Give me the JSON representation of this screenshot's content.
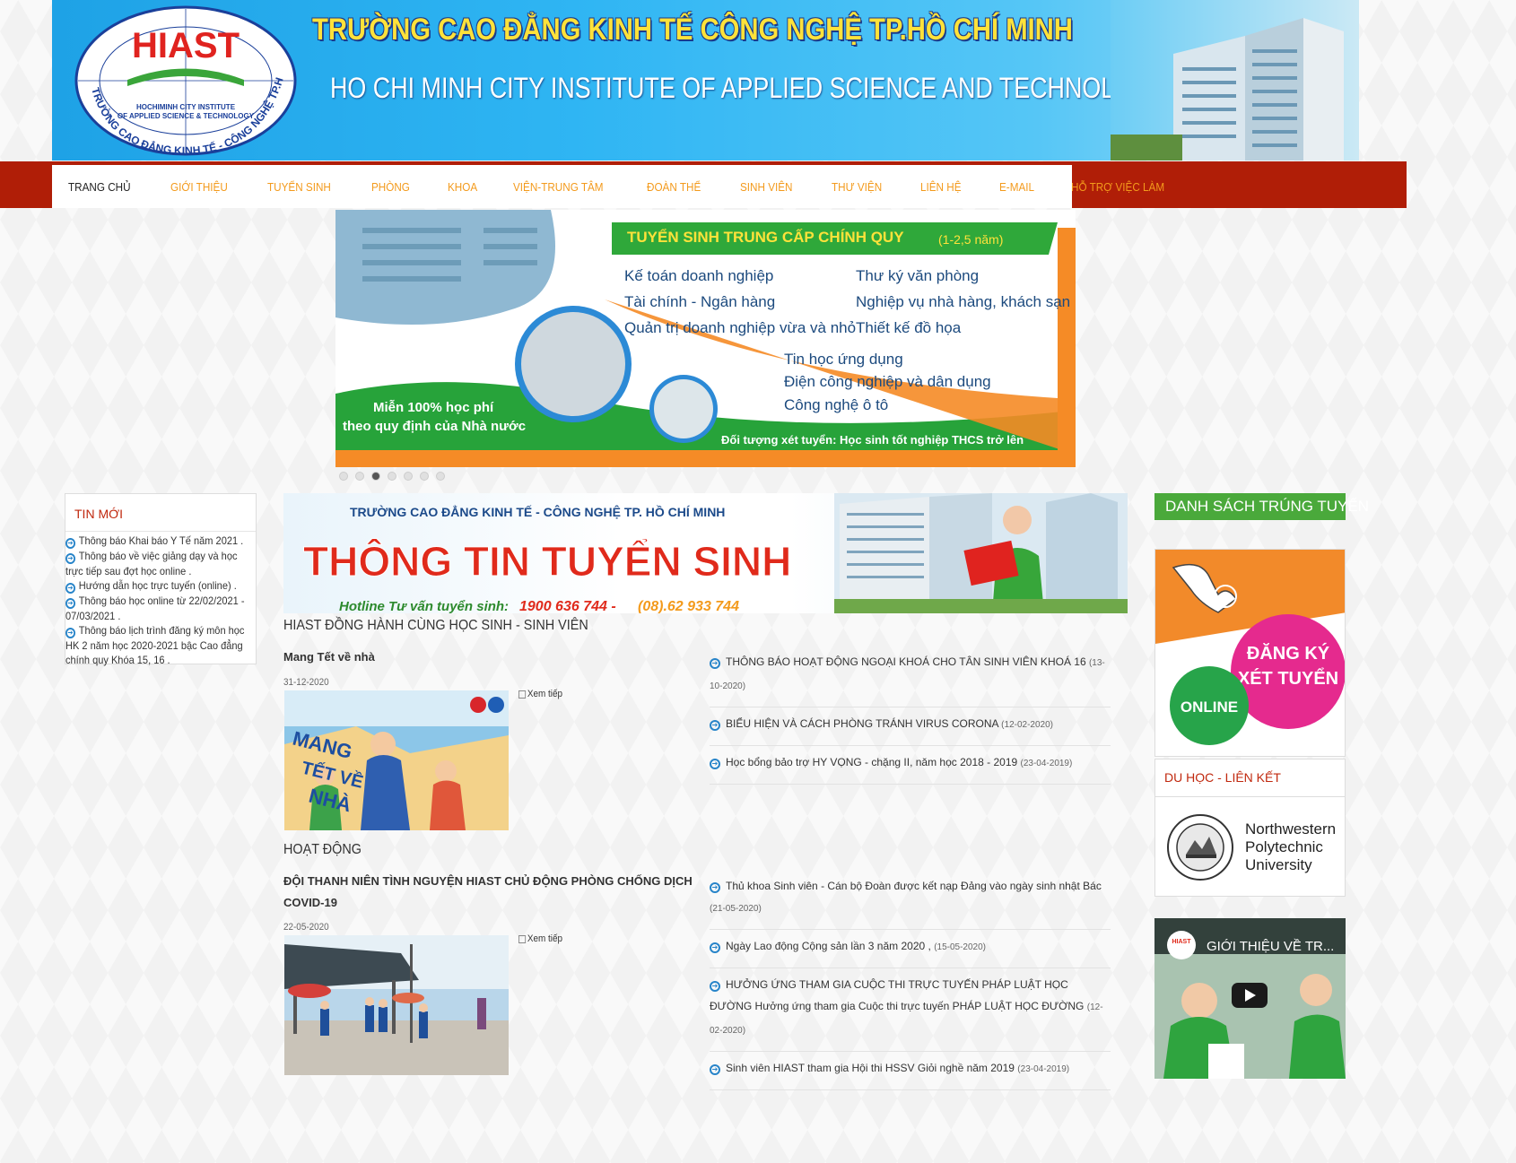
{
  "header": {
    "logo_text": "HIAST",
    "logo_sub1": "HOCHIMINH CITY INSTITUTE",
    "logo_sub2": "OF APPLIED SCIENCE & TECHNOLOGY",
    "logo_ring": "TRƯỜNG CAO ĐẲNG KINH TẾ - CÔNG NGHỆ TP.HCM",
    "title_vn": "TRƯỜNG CAO ĐẲNG KINH TẾ CÔNG NGHỆ TP.HỒ CHÍ MINH",
    "title_en": "HO CHI MINH CITY INSTITUTE OF APPLIED SCIENCE AND TECHNOLOGY"
  },
  "nav": {
    "items": [
      {
        "label": "TRANG CHỦ"
      },
      {
        "label": "GIỚI THIỆU"
      },
      {
        "label": "TUYỂN SINH"
      },
      {
        "label": "PHÒNG"
      },
      {
        "label": "KHOA"
      },
      {
        "label": "VIỆN-TRUNG TÂM"
      },
      {
        "label": "ĐOÀN THỂ"
      },
      {
        "label": "SINH VIÊN"
      },
      {
        "label": "THƯ VIỆN"
      },
      {
        "label": "LIÊN HỆ"
      },
      {
        "label": "E-MAIL"
      },
      {
        "label": "HỖ TRỢ VIỆC LÀM"
      }
    ],
    "active_index": 0
  },
  "slider": {
    "headline": "TUYỂN SINH TRUNG CẤP CHÍNH QUY",
    "duration": "(1-2,5 năm)",
    "programs_col1": [
      "Kế toán doanh nghiệp",
      "Tài chính - Ngân hàng",
      "Quản trị doanh nghiệp vừa và nhỏ"
    ],
    "programs_col2": [
      "Thư ký văn phòng",
      "Nghiệp vụ nhà hàng, khách sạn",
      "Thiết kế đồ họa"
    ],
    "programs_col3": [
      "Tin học ứng dụng",
      "Điện công nghiệp và dân dụng",
      "Công nghệ ô tô"
    ],
    "fee_line1": "Miễn 100% học phí",
    "fee_line2": "theo quy định của Nhà nước",
    "target": "Đối tượng xét tuyển:  Học sinh tốt nghiệp THCS trở lên",
    "dot_count": 7,
    "active_dot": 2
  },
  "left_sidebar": {
    "title": "TIN MỚI",
    "items": [
      "Thông báo Khai báo Y Tế năm 2021 .",
      "Thông báo về việc giảng dạy và học trực tiếp sau đợt học online .",
      "Hướng dẫn học trực tuyến (online) .",
      "Thông báo học online từ 22/02/2021 - 07/03/2021 .",
      "Thông báo lịch trình đăng ký môn học HK 2 năm học 2020-2021 bậc Cao đẳng chính quy Khóa 15, 16 ."
    ]
  },
  "ts_banner": {
    "school": "TRƯỜNG CAO ĐẲNG KINH TẾ - CÔNG NGHỆ TP. HỒ CHÍ MINH",
    "headline": "THÔNG TIN TUYỂN SINH",
    "hotline_label": "Hotline Tư vấn tuyển sinh:",
    "hotline_1": "1900 636 744 -",
    "hotline_2": "(08).62 933 744"
  },
  "section1": {
    "title": "HIAST ĐỒNG HÀNH CÙNG HỌC SINH - SINH VIÊN",
    "featured_title": "Mang Tết về nhà",
    "featured_date": "31-12-2020",
    "read_more": "Xem tiếp",
    "news": [
      {
        "text": "THÔNG BÁO HOẠT ĐỘNG NGOẠI KHOÁ CHO TÂN SINH VIÊN KHOÁ 16",
        "date": "(13-10-2020)"
      },
      {
        "text": "BIỂU HIỆN VÀ CÁCH PHÒNG TRÁNH VIRUS CORONA",
        "date": "(12-02-2020)"
      },
      {
        "text": "Học bổng bảo trợ HY VỌNG - chặng II, năm học 2018 - 2019",
        "date": "(23-04-2019)"
      }
    ]
  },
  "section2": {
    "title": "HOẠT ĐỘNG",
    "featured_title": "ĐỘI THANH NIÊN TÌNH NGUYỆN HIAST CHỦ ĐỘNG PHÒNG CHỐNG DỊCH COVID-19",
    "featured_date": "22-05-2020",
    "read_more": "Xem tiếp",
    "news": [
      {
        "text": "Thủ khoa Sinh viên - Cán bộ Đoàn được kết nạp Đảng vào ngày sinh nhật Bác",
        "date": "(21-05-2020)"
      },
      {
        "text": "Ngày Lao động Cộng sản lần 3 năm 2020 ,",
        "date": "(15-05-2020)"
      },
      {
        "text": "HƯỞNG ỨNG THAM GIA CUỘC THI TRỰC TUYẾN PHÁP LUẬT HỌC ĐƯỜNG Hưởng ứng tham gia Cuộc thi trực tuyến PHÁP LUẬT HỌC ĐƯỜNG",
        "date": "(12-02-2020)"
      },
      {
        "text": "Sinh viên HIAST tham gia Hội thi HSSV Giỏi nghề năm 2019",
        "date": "(23-04-2019)"
      }
    ]
  },
  "right_sidebar": {
    "dstt_label": "DANH SÁCH TRÚNG TUYỂN",
    "dangky_line1": "ĐĂNG KÝ",
    "dangky_line2": "XÉT TUYỂN",
    "online_label": "ONLINE",
    "duhoc_title": "DU HỌC - LIÊN KẾT",
    "partner_line1": "Northwestern",
    "partner_line2": "Polytechnic",
    "partner_line3": "University",
    "video_title": "GIỚI THIỆU VỀ TR..."
  }
}
